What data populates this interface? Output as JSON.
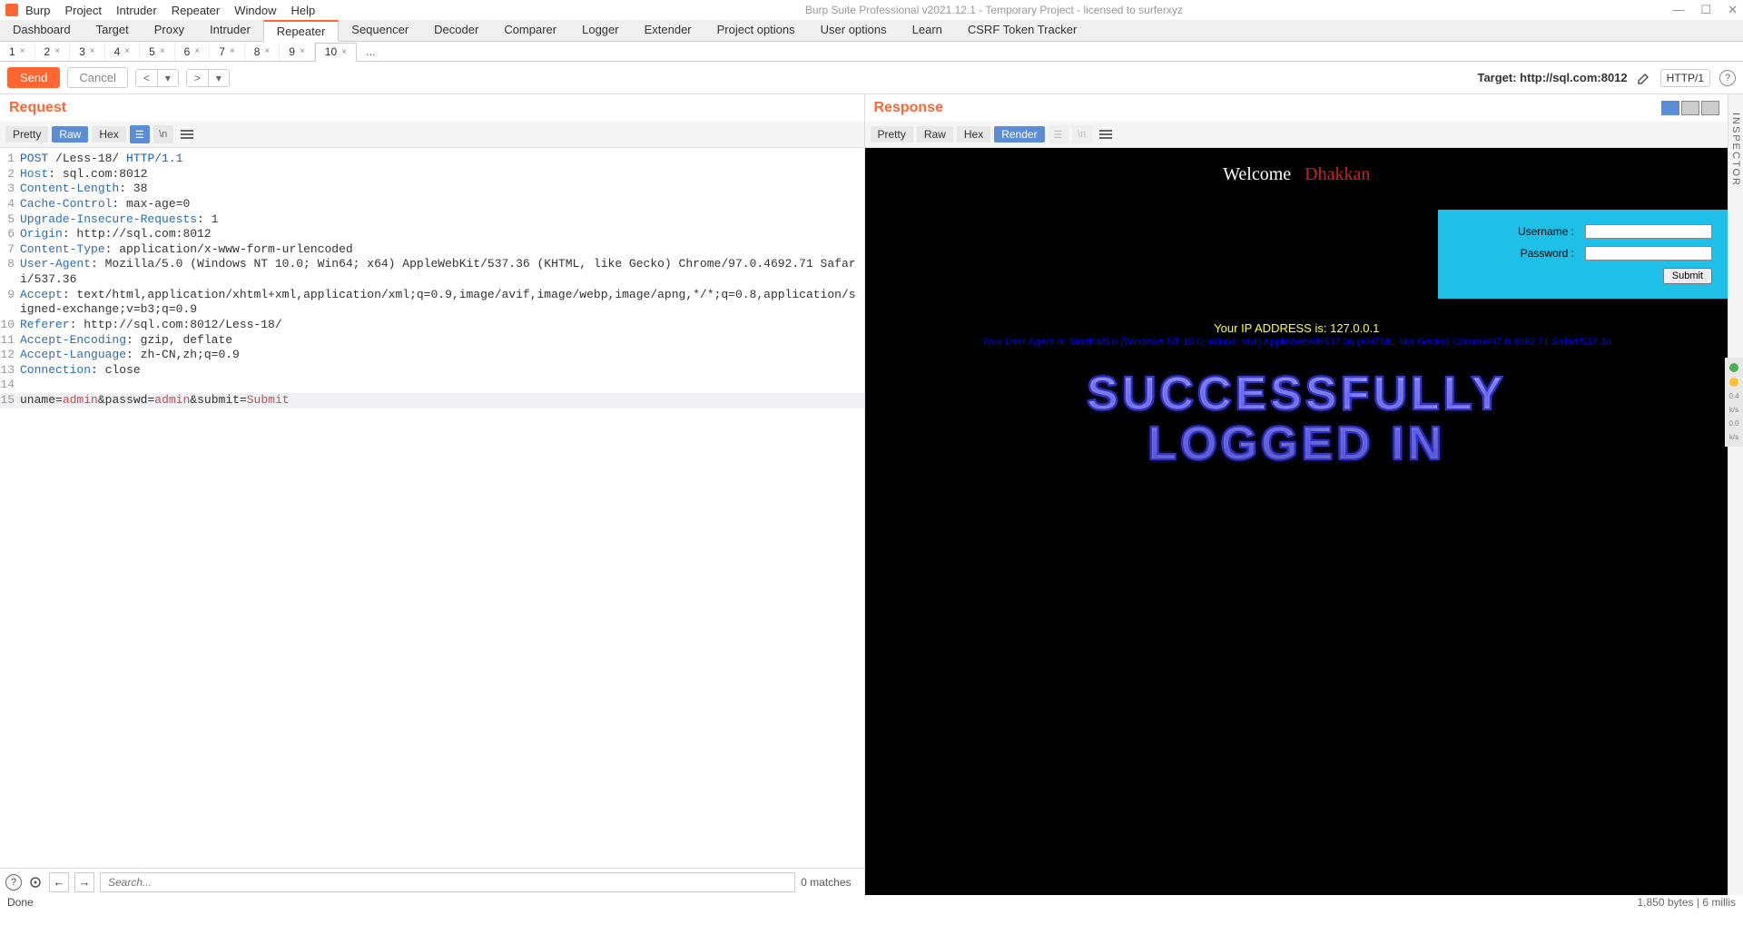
{
  "titlebar": {
    "menus": [
      "Burp",
      "Project",
      "Intruder",
      "Repeater",
      "Window",
      "Help"
    ],
    "title": "Burp Suite Professional v2021.12.1 - Temporary Project - licensed to surferxyz"
  },
  "maintabs": [
    "Dashboard",
    "Target",
    "Proxy",
    "Intruder",
    "Repeater",
    "Sequencer",
    "Decoder",
    "Comparer",
    "Logger",
    "Extender",
    "Project options",
    "User options",
    "Learn",
    "CSRF Token Tracker"
  ],
  "maintabs_active": 4,
  "subtabs": [
    "1",
    "2",
    "3",
    "4",
    "5",
    "6",
    "7",
    "8",
    "9",
    "10"
  ],
  "subtabs_active": 9,
  "subtabs_more": "...",
  "toolbar": {
    "send": "Send",
    "cancel": "Cancel",
    "target_label": "Target: http://sql.com:8012",
    "http_ver": "HTTP/1"
  },
  "request": {
    "title": "Request",
    "views": [
      "Pretty",
      "Raw",
      "Hex"
    ],
    "view_active": 1,
    "lines": [
      {
        "n": 1,
        "method": "POST",
        "path": " /Less-18/ ",
        "proto": "HTTP/1.1"
      },
      {
        "n": 2,
        "h": "Host",
        "v": "sql.com:8012"
      },
      {
        "n": 3,
        "h": "Content-Length",
        "v": "38"
      },
      {
        "n": 4,
        "h": "Cache-Control",
        "v": "max-age=0"
      },
      {
        "n": 5,
        "h": "Upgrade-Insecure-Requests",
        "v": "1"
      },
      {
        "n": 6,
        "h": "Origin",
        "v": "http://sql.com:8012"
      },
      {
        "n": 7,
        "h": "Content-Type",
        "v": "application/x-www-form-urlencoded"
      },
      {
        "n": 8,
        "h": "User-Agent",
        "v": "Mozilla/5.0 (Windows NT 10.0; Win64; x64) AppleWebKit/537.36 (KHTML, like Gecko) Chrome/97.0.4692.71 Safari/537.36"
      },
      {
        "n": 9,
        "h": "Accept",
        "v": "text/html,application/xhtml+xml,application/xml;q=0.9,image/avif,image/webp,image/apng,*/*;q=0.8,application/signed-exchange;v=b3;q=0.9"
      },
      {
        "n": 10,
        "h": "Referer",
        "v": "http://sql.com:8012/Less-18/"
      },
      {
        "n": 11,
        "h": "Accept-Encoding",
        "v": "gzip, deflate"
      },
      {
        "n": 12,
        "h": "Accept-Language",
        "v": "zh-CN,zh;q=0.9"
      },
      {
        "n": 13,
        "h": "Connection",
        "v": "close"
      },
      {
        "n": 14,
        "blank": true
      },
      {
        "n": 15,
        "body": [
          [
            "uname",
            "admin"
          ],
          [
            "passwd",
            "admin"
          ],
          [
            "submit",
            "Submit"
          ]
        ]
      }
    ]
  },
  "response": {
    "title": "Response",
    "views": [
      "Pretty",
      "Raw",
      "Hex",
      "Render"
    ],
    "view_active": 3
  },
  "render": {
    "welcome": "Welcome",
    "dhakkan": "Dhakkan",
    "username_label": "Username :",
    "password_label": "Password :",
    "submit_label": "Submit",
    "ip_line_prefix": "Your IP ADDRESS is",
    "ip_value": "127.0.0.1",
    "ua_line": "Your User Agent is: Mozilla/5.0 (Windows NT 10.0; Win64; x64) AppleWebKit/537.36 (KHTML, like Gecko) Chrome/97.0.4692.71 Safari/537.36",
    "big1": "SUCCESSFULLY",
    "big2": "LOGGED IN"
  },
  "search": {
    "placeholder": "Search...",
    "matches": "0 matches"
  },
  "status": {
    "left": "Done",
    "right": "1,850 bytes | 6 millis"
  },
  "inspector_label": "INSPECTOR",
  "side": {
    "v1": "0.4",
    "u1": "k/s",
    "v2": "0.0",
    "u2": "k/s"
  }
}
